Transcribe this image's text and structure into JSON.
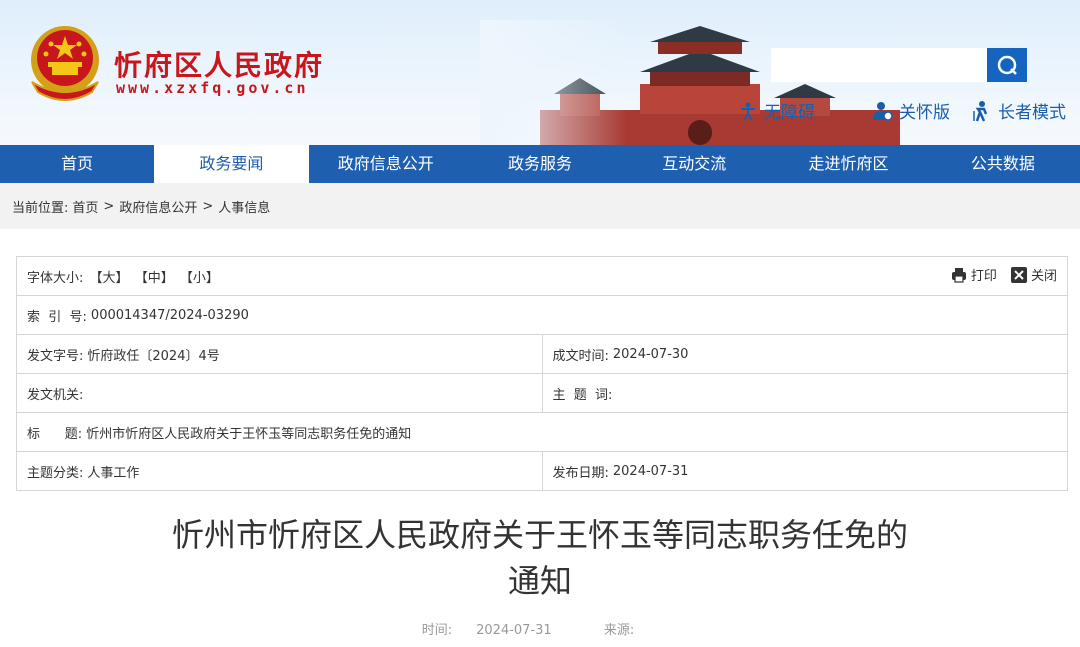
{
  "site": {
    "name": "忻府区人民政府",
    "url": "www.xzxfq.gov.cn"
  },
  "header": {
    "search_placeholder": "",
    "links": [
      {
        "label": "无障碍",
        "icon": "accessibility-icon"
      },
      {
        "label": "关怀版",
        "icon": "care-mode-icon"
      },
      {
        "label": "长者模式",
        "icon": "elder-mode-icon"
      }
    ]
  },
  "nav": {
    "items": [
      "首页",
      "政务要闻",
      "政府信息公开",
      "政务服务",
      "互动交流",
      "走进忻府区",
      "公共数据"
    ],
    "active_index": 1
  },
  "breadcrumb": {
    "prefix": "当前位置:",
    "items": [
      "首页",
      "政府信息公开",
      "人事信息"
    ],
    "separator": ">"
  },
  "info": {
    "font_size_label": "字体大小:",
    "font_sizes": [
      "【大】",
      "【中】",
      "【小】"
    ],
    "print_label": "打印",
    "close_label": "关闭",
    "index_key": "索  引  号:",
    "index_value": "000014347/2024-03290",
    "doc_no_key": "发文字号:",
    "doc_no_value": "忻府政任〔2024〕4号",
    "created_key": "成文时间:",
    "created_value": "2024-07-30",
    "issuer_key": "发文机关:",
    "issuer_value": "",
    "keywords_key": "主  题  词:",
    "keywords_value": "",
    "title_key": "标      题:",
    "title_value": "忻州市忻府区人民政府关于王怀玉等同志职务任免的通知",
    "category_key": "主题分类:",
    "category_value": "人事工作",
    "publish_key": "发布日期:",
    "publish_value": "2024-07-31"
  },
  "article": {
    "title_line1": "忻州市忻府区人民政府关于王怀玉等同志职务任免的",
    "title_line2": "通知",
    "time_label": "时间:",
    "time_value": "2024-07-31",
    "source_label": "来源:",
    "source_value": ""
  },
  "colors": {
    "brand_red": "#c8161d",
    "nav_blue": "#1f5fb0",
    "link_blue": "#1a5eab"
  }
}
